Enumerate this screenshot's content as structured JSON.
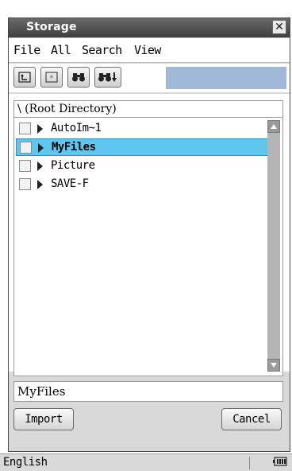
{
  "window": {
    "title": "Storage",
    "close_glyph": "✕"
  },
  "menu": {
    "items": [
      "File",
      "All",
      "Search",
      "View"
    ]
  },
  "toolbar": {
    "buttons": [
      {
        "name": "parent-folder-icon",
        "glyph": "⮤"
      },
      {
        "name": "new-folder-icon",
        "glyph": "✳"
      },
      {
        "name": "binoculars-icon",
        "glyph": "👓"
      },
      {
        "name": "binoculars-next-icon",
        "glyph": "👓"
      }
    ]
  },
  "browser": {
    "path": "\\ (Root Directory)",
    "items": [
      {
        "label": "AutoIm~1",
        "selected": false
      },
      {
        "label": "MyFiles",
        "selected": true
      },
      {
        "label": "Picture",
        "selected": false
      },
      {
        "label": "SAVE-F",
        "selected": false
      }
    ]
  },
  "name_field": {
    "value": "MyFiles"
  },
  "actions": {
    "import_label": "Import",
    "cancel_label": "Cancel"
  },
  "status": {
    "language": "English",
    "battery_icon": "battery-icon"
  }
}
